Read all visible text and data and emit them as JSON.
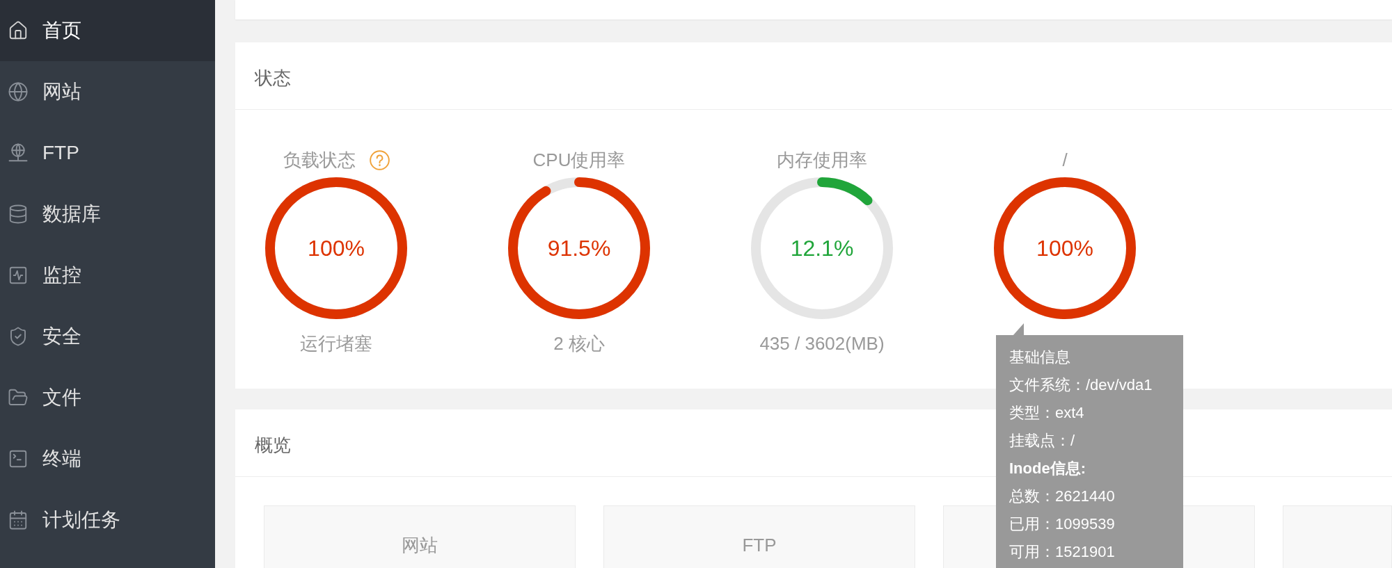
{
  "sidebar": {
    "items": [
      {
        "label": "首页",
        "selected": true
      },
      {
        "label": "网站",
        "selected": false
      },
      {
        "label": "FTP",
        "selected": false
      },
      {
        "label": "数据库",
        "selected": false
      },
      {
        "label": "监控",
        "selected": false
      },
      {
        "label": "安全",
        "selected": false
      },
      {
        "label": "文件",
        "selected": false
      },
      {
        "label": "终端",
        "selected": false
      },
      {
        "label": "计划任务",
        "selected": false
      }
    ]
  },
  "status": {
    "title": "状态",
    "gauges": [
      {
        "title": "负载状态",
        "help": true,
        "level": 1,
        "value": "100%",
        "caption": "运行堵塞",
        "color": "#dd3300"
      },
      {
        "title": "CPU使用率",
        "help": false,
        "level": 0.915,
        "value": "91.5%",
        "caption": "2 核心",
        "color": "#dd3300"
      },
      {
        "title": "内存使用率",
        "help": false,
        "level": 0.121,
        "value": "12.1%",
        "caption": "435 / 3602(MB)",
        "color": "#20a53a"
      },
      {
        "title": "/",
        "help": false,
        "level": 1,
        "value": "100%",
        "color": "#dd3300"
      }
    ]
  },
  "tooltip": {
    "lines": [
      {
        "text": "基础信息",
        "bold": false
      },
      {
        "text": "文件系统：/dev/vda1",
        "bold": false
      },
      {
        "text": "类型：ext4",
        "bold": false
      },
      {
        "text": "挂载点：/",
        "bold": false
      },
      {
        "text": "Inode信息:",
        "bold": true
      },
      {
        "text": "总数：2621440",
        "bold": false
      },
      {
        "text": "已用：1099539",
        "bold": false
      },
      {
        "text": "可用：1521901",
        "bold": false
      }
    ]
  },
  "overview": {
    "title": "概览",
    "tiles": [
      {
        "title": "网站"
      },
      {
        "title": "FTP"
      }
    ]
  }
}
